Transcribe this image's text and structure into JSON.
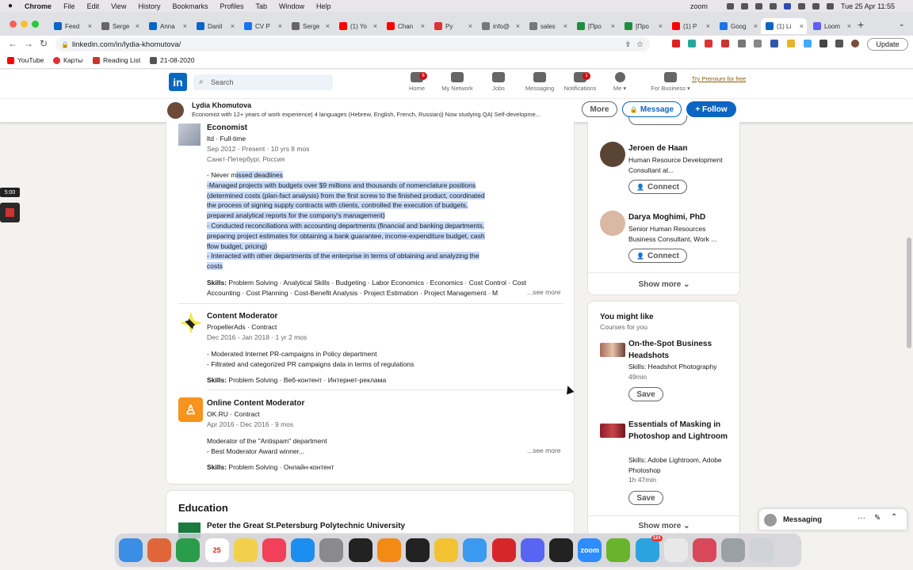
{
  "menubar": {
    "apple": "",
    "app": "Chrome",
    "items": [
      "File",
      "Edit",
      "View",
      "History",
      "Bookmarks",
      "Profiles",
      "Tab",
      "Window",
      "Help"
    ],
    "zoom_label": "zoom",
    "datetime": "Tue 25 Apr  11:55"
  },
  "tabs": [
    {
      "label": "Feed",
      "color": "#0a66c2"
    },
    {
      "label": "Serge",
      "color": "#666"
    },
    {
      "label": "Anna",
      "color": "#0a66c2"
    },
    {
      "label": "Danil",
      "color": "#0a66c2"
    },
    {
      "label": "CV P",
      "color": "#1a73e8"
    },
    {
      "label": "Serge",
      "color": "#666"
    },
    {
      "label": "(1) Yo",
      "color": "#f00"
    },
    {
      "label": "Chan",
      "color": "#f00"
    },
    {
      "label": "Py",
      "color": "#d33"
    },
    {
      "label": "info@",
      "color": "#777"
    },
    {
      "label": "sales",
      "color": "#777"
    },
    {
      "label": "[Про",
      "color": "#1e8e3e"
    },
    {
      "label": "[Про",
      "color": "#1e8e3e"
    },
    {
      "label": "(1) P",
      "color": "#f00"
    },
    {
      "label": "Goog",
      "color": "#1a73e8"
    },
    {
      "label": "(1) Li",
      "color": "#0a66c2"
    },
    {
      "label": "Loom",
      "color": "#625df5"
    }
  ],
  "address": {
    "url": "linkedin.com/in/lydia-khomutova/",
    "update_label": "Update"
  },
  "bookmarks": [
    {
      "label": "YouTube",
      "color": "#f00"
    },
    {
      "label": "Карты",
      "color": "#d33"
    },
    {
      "label": "Reading List",
      "color": "#c33"
    },
    {
      "label": "21-08-2020",
      "color": "#555"
    }
  ],
  "header": {
    "logo": "in",
    "search_placeholder": "Search",
    "nav": [
      {
        "label": "Home",
        "badge": "8"
      },
      {
        "label": "My Network",
        "badge": ""
      },
      {
        "label": "Jobs",
        "badge": ""
      },
      {
        "label": "Messaging",
        "badge": ""
      },
      {
        "label": "Notifications",
        "badge": "1"
      },
      {
        "label": "Me ▾",
        "badge": ""
      },
      {
        "label": "For Business ▾",
        "badge": ""
      }
    ],
    "premium": "Try Premium for free"
  },
  "profile": {
    "name": "Lydia Khomutova",
    "headline": "Economist with 12+ years of work experience| 4 languages (Hebrew, English, French, Russian)| Now studying QA| Self-developme...",
    "more": "More",
    "message": "Message",
    "follow": "+ Follow"
  },
  "experience": [
    {
      "title": "Economist",
      "company": "ltd · Full-time",
      "dates": "Sep 2012 - Present · 10 yrs 8 mos",
      "location": "Санкт-Петербург, Россия",
      "desc_first_plain": "- Never m",
      "desc_first_hl": "issed deadlines",
      "desc_hl": [
        "-Managed projects with budgets over $9 millions and thousands of nomenclature positions",
        "(determined costs (plan-fact analysis) from the first screw to the finished product, coordinated",
        "the process of signing supply contracts with clients, controlled the execution of budgets,",
        "prepared analytical reports for the company's management)",
        "- Conducted reconciliations with accounting departments (financial and banking departments,",
        "preparing project estimates for obtaining a bank guarantee, income-expenditure budget, cash",
        "flow budget, pricing)",
        "- Interacted with other departments of the enterprise in terms of obtaining and analyzing the",
        "costs"
      ],
      "skills_label": "Skills:",
      "skills_l1": " Problem Solving · Analytical Skills · Budgeting · Labor Economics · Economics · Cost Control · Cost",
      "skills_l2": "Accounting · Cost Planning · Cost-Benefit Analysis · Project Estimation · Project Management · M",
      "see_more": "...see more"
    },
    {
      "title": "Content Moderator",
      "company": "PropellerAds · Contract",
      "dates": "Dec 2016 - Jan 2018 · 1 yr 2 mos",
      "desc": [
        "- Moderated Internet PR-campaigns in Policy department",
        "- Filtrated and categorized PR campaigns data in terms of regulations"
      ],
      "skills_label": "Skills:",
      "skills": " Problem Solving · Веб-контент · Интернет-реклама"
    },
    {
      "title": "Online Content Moderator",
      "company": "OK.RU · Contract",
      "dates": "Apr 2016 - Dec 2016 · 9 mos",
      "desc": [
        "Moderator of the \"Antispam\" department",
        "- Best Moderator Award winner..."
      ],
      "see_more": "...see more",
      "skills_label": "Skills:",
      "skills": " Problem Solving · Онлайн-контент"
    }
  ],
  "education": {
    "heading": "Education",
    "school": "Peter the Great St.Petersburg Polytechnic University"
  },
  "people": [
    {
      "name": "Jeroen de Haan",
      "headline": "Human Resource Development Consultant at...",
      "button": "Connect"
    },
    {
      "name": "Darya Moghimi, PhD",
      "headline": "Senior Human Resources Business Consultant, Work ...",
      "button": "Connect"
    }
  ],
  "show_more": "Show more ⌄",
  "courses": {
    "title": "You might like",
    "subtitle": "Courses for you",
    "items": [
      {
        "title": "On-the-Spot Business Headshots",
        "skills": "Skills: Headshot Photography",
        "duration": "49min",
        "button": "Save"
      },
      {
        "title": "Essentials of Masking in Photoshop and Lightroom",
        "skills": "Skills: Adobe Lightroom, Adobe Photoshop",
        "duration": "1h 47min",
        "button": "Save"
      }
    ],
    "show_more": "Show more ⌄"
  },
  "messaging": {
    "label": "Messaging"
  },
  "zoom": {
    "timer": "5:00"
  },
  "dock": [
    {
      "name": "finder-icon",
      "color": "#3a8ee6"
    },
    {
      "name": "launchpad-icon",
      "color": "#e0663a"
    },
    {
      "name": "chrome-icon",
      "color": "#2a9d4a"
    },
    {
      "name": "calendar-icon",
      "color": "#ffffff",
      "text": "25"
    },
    {
      "name": "notes-icon",
      "color": "#f2d04b"
    },
    {
      "name": "music-icon",
      "color": "#f2405a"
    },
    {
      "name": "app-store-icon",
      "color": "#1c8ef0"
    },
    {
      "name": "settings-icon",
      "color": "#8a8a8e"
    },
    {
      "name": "activity-monitor-icon",
      "color": "#222"
    },
    {
      "name": "vlc-icon",
      "color": "#f28a14"
    },
    {
      "name": "terminal-icon",
      "color": "#222"
    },
    {
      "name": "cyberduck-icon",
      "color": "#f2c230"
    },
    {
      "name": "mail-icon",
      "color": "#3b9af0"
    },
    {
      "name": "acrobat-icon",
      "color": "#d7262b"
    },
    {
      "name": "discord-icon",
      "color": "#5865f2"
    },
    {
      "name": "figma-icon",
      "color": "#222"
    },
    {
      "name": "zoom-icon",
      "color": "#2d8cff",
      "text": "zoom"
    },
    {
      "name": "utorrent-icon",
      "color": "#6ab42b"
    },
    {
      "name": "telegram-icon",
      "color": "#2aa3e0",
      "badge": "124"
    },
    {
      "name": "chrome-apps-icon",
      "color": "#e8e8e8"
    },
    {
      "name": "preview-icon",
      "color": "#d9485a"
    },
    {
      "name": "downloads-icon",
      "color": "#9aa0a6"
    },
    {
      "name": "trash-icon",
      "color": "#cfd2d6"
    }
  ]
}
